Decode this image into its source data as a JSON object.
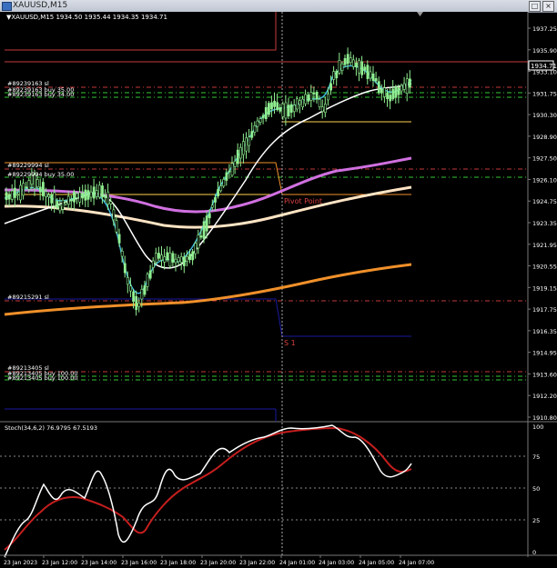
{
  "window": {
    "title": "XAUUSD,M15",
    "max_glyph": "□",
    "close_glyph": "×"
  },
  "info_line": "▼XAUUSD,M15  1934.50 1935.44 1934.35 1934.71",
  "stoch_label": "Stoch(34,6,2) 76.9795 67.5193",
  "current_price": "1934.71",
  "price_axis": [
    "1937.25",
    "1935.90",
    "1933.10",
    "1931.75",
    "1930.30",
    "1928.90",
    "1927.50",
    "1926.10",
    "1924.75",
    "1923.35",
    "1921.95",
    "1920.55",
    "1919.15",
    "1917.75",
    "1916.35",
    "1914.95",
    "1913.60",
    "1912.20",
    "1910.80"
  ],
  "stoch_axis": [
    "100",
    "75",
    "50",
    "25",
    "0"
  ],
  "time_axis": [
    "23 Jan 2023",
    "23 Jan 12:00",
    "23 Jan 14:00",
    "23 Jan 16:00",
    "23 Jan 18:00",
    "23 Jan 20:00",
    "23 Jan 22:00",
    "24 Jan 01:00",
    "24 Jan 03:00",
    "24 Jan 05:00",
    "24 Jan 07:00"
  ],
  "order_labels": {
    "o1_sl": "#89239163 sl",
    "o1_buy": "#89239163 buy 35.00",
    "o1_tp": "#89239163 buy 34.00",
    "o2_sl": "#89229994 sl",
    "o2_buy": "#89229994 buy 35.00",
    "o3_sl": "#89215291 sl",
    "o4_sl": "#89213405 sl",
    "o4_buy": "#89213405 buy 100.00",
    "o4_buy2": "#89213405 buy 100.00"
  },
  "pivot_label": "Pivot Point",
  "s1_label": "S 1",
  "colors": {
    "bg": "#000000",
    "bull": "#90ee90",
    "bear": "#000000",
    "ma_fast": "#3fb6d6",
    "ma_white": "#ffffff",
    "ma_violet": "#d070e0",
    "ma_bisque": "#ffe4c4",
    "ma_orange": "#f0902a",
    "pivot": "#ffd24a",
    "stop_line": "#c43a3a",
    "green_dash": "#33c833",
    "navy": "#1a1aa0",
    "stoch_main": "#ffffff",
    "stoch_signal": "#c41e1e"
  }
}
